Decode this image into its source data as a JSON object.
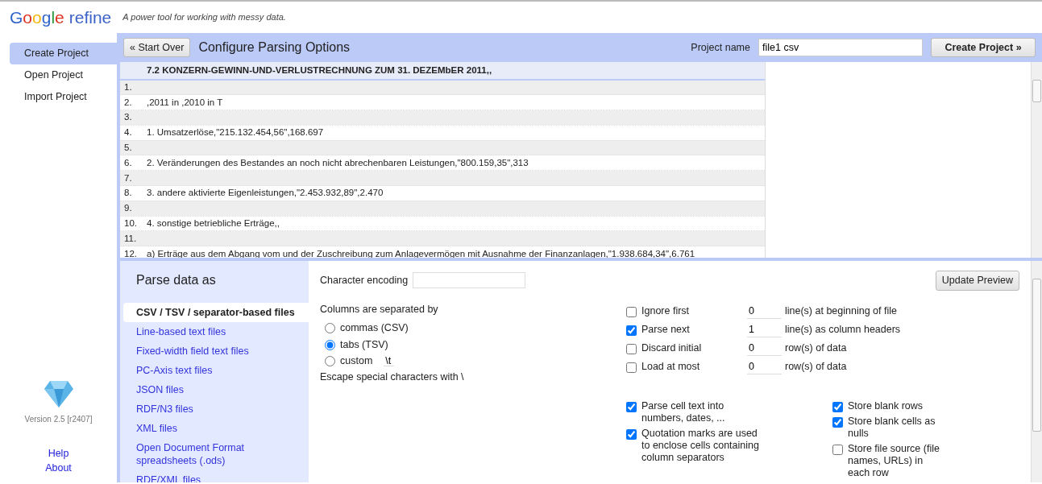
{
  "header": {
    "logo_google": "Google",
    "logo_refine": "refine",
    "tagline": "A power tool for working with messy data."
  },
  "sidebar": {
    "items": [
      {
        "label": "Create Project",
        "selected": true
      },
      {
        "label": "Open Project",
        "selected": false
      },
      {
        "label": "Import Project",
        "selected": false
      }
    ],
    "version": "Version 2.5 [r2407]",
    "links": [
      "Help",
      "About"
    ]
  },
  "toolbar": {
    "start_over": "« Start Over",
    "title": "Configure Parsing Options",
    "project_name_label": "Project name",
    "project_name": "file1 csv",
    "create_button": "Create Project »"
  },
  "preview": {
    "header": "7.2 KONZERN-GEWINN-UND-VERLUSTRECHNUNG ZUM 31. DEZEMbER 2011,,",
    "rows": [
      {
        "number": "1.",
        "text": ""
      },
      {
        "number": "2.",
        "text": ",2011 in ,2010 in T"
      },
      {
        "number": "3.",
        "text": ""
      },
      {
        "number": "4.",
        "text": "1. Umsatzerlöse,\"215.132.454,56\",168.697"
      },
      {
        "number": "5.",
        "text": ""
      },
      {
        "number": "6.",
        "text": "2. Veränderungen des Bestandes an noch nicht abrechenbaren Leistungen,\"800.159,35\",313"
      },
      {
        "number": "7.",
        "text": ""
      },
      {
        "number": "8.",
        "text": "3. andere aktivierte Eigenleistungen,\"2.453.932,89\",2.470"
      },
      {
        "number": "9.",
        "text": ""
      },
      {
        "number": "10.",
        "text": "4. sonstige betriebliche Erträge,,"
      },
      {
        "number": "11.",
        "text": ""
      },
      {
        "number": "12.",
        "text": "a) Erträge aus dem Abgang vom und der Zuschreibung zum Anlagevermögen mit Ausnahme der Finanzanlagen,\"1.938.684,34\",6.761"
      }
    ]
  },
  "formats": {
    "title": "Parse data as",
    "items": [
      {
        "label": "CSV / TSV / separator-based files",
        "selected": true
      },
      {
        "label": "Line-based text files",
        "selected": false
      },
      {
        "label": "Fixed-width field text files",
        "selected": false
      },
      {
        "label": "PC-Axis text files",
        "selected": false
      },
      {
        "label": "JSON files",
        "selected": false
      },
      {
        "label": "RDF/N3 files",
        "selected": false
      },
      {
        "label": "XML files",
        "selected": false
      },
      {
        "label": "Open Document Format spreadsheets (.ods)",
        "selected": false
      },
      {
        "label": "RDF/XML files",
        "selected": false
      }
    ]
  },
  "options": {
    "encoding_label": "Character encoding",
    "update_button": "Update Preview",
    "separator_label": "Columns are separated by",
    "separators": [
      {
        "label": "commas (CSV)",
        "selected": false
      },
      {
        "label": "tabs (TSV)",
        "selected": true
      },
      {
        "label": "custom",
        "selected": false,
        "value": "\\t"
      }
    ],
    "escape_label": "Escape special characters with \\",
    "line_options": [
      {
        "label": "Ignore first",
        "checked": false,
        "value": "0",
        "suffix": "line(s) at beginning of file"
      },
      {
        "label": "Parse next",
        "checked": true,
        "value": "1",
        "suffix": "line(s) as column headers"
      },
      {
        "label": "Discard initial",
        "checked": false,
        "value": "0",
        "suffix": "row(s) of data"
      },
      {
        "label": "Load at most",
        "checked": false,
        "value": "0",
        "suffix": "row(s) of data"
      }
    ],
    "left_checks": [
      {
        "label": "Parse cell text into numbers, dates, ...",
        "checked": true
      },
      {
        "label": "Quotation marks are used to enclose cells containing column separators",
        "checked": true
      }
    ],
    "right_checks": [
      {
        "label": "Store blank rows",
        "checked": true
      },
      {
        "label": "Store blank cells as nulls",
        "checked": true
      },
      {
        "label": "Store file source (file names, URLs) in each row",
        "checked": false
      }
    ]
  }
}
